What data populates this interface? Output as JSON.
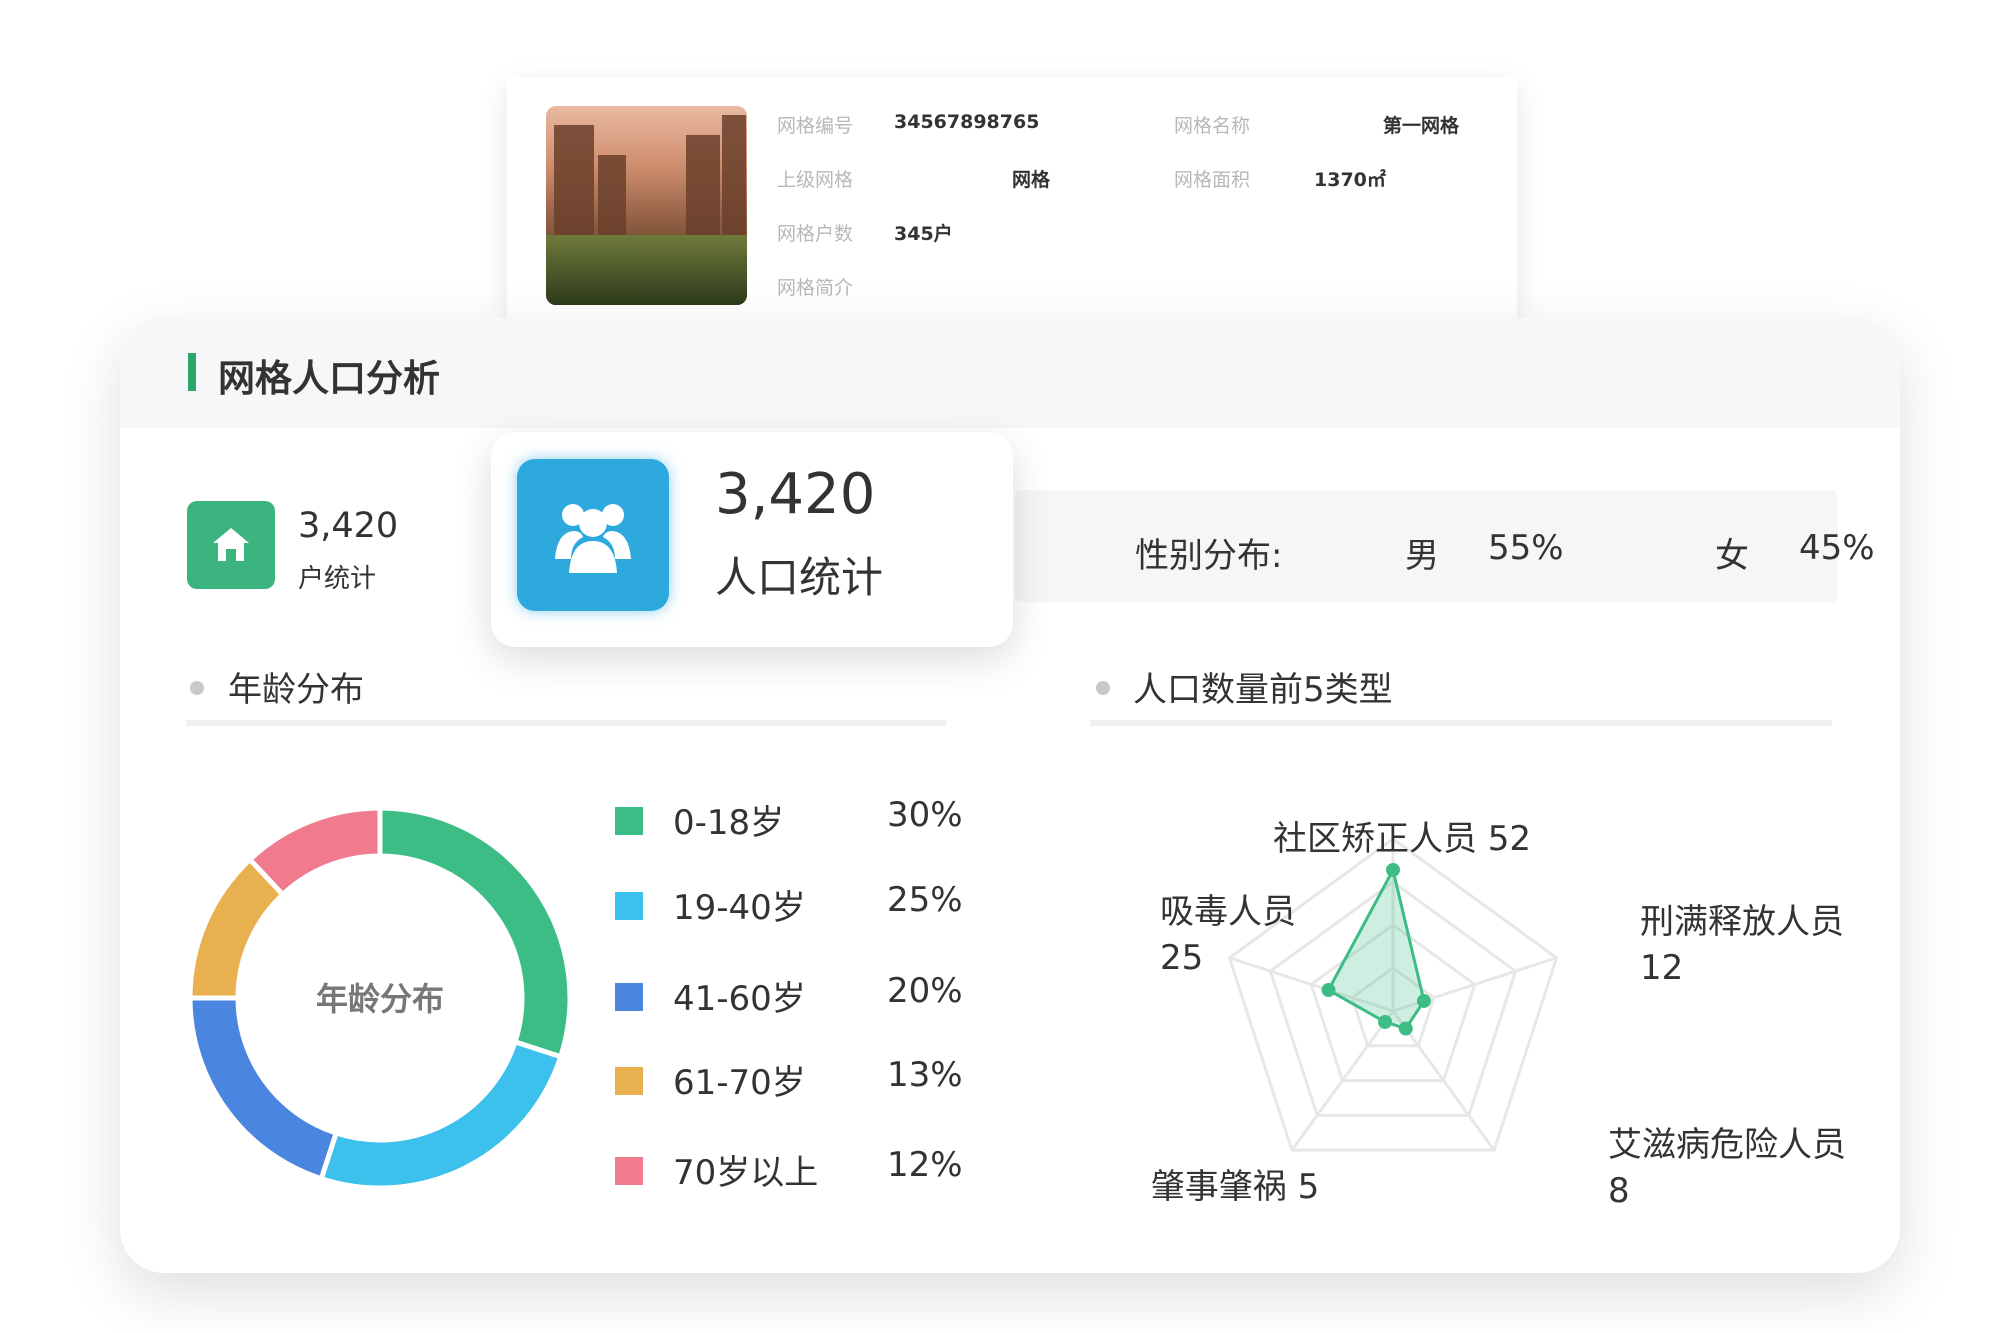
{
  "grid_info": {
    "fields": [
      {
        "label": "网格编号",
        "value": "34567898765"
      },
      {
        "label": "网格名称",
        "value": "第一网格"
      },
      {
        "label": "上级网格",
        "value": "网格"
      },
      {
        "label": "网格面积",
        "value": "1370㎡"
      },
      {
        "label": "网格户数",
        "value": "345户"
      },
      {
        "label": "网格简介",
        "value": ""
      }
    ]
  },
  "analysis": {
    "title": "网格人口分析",
    "households": {
      "value": "3,420",
      "label": "户统计"
    },
    "population": {
      "value": "3,420",
      "label": "人口统计"
    },
    "gender": {
      "label": "性别分布:",
      "male_label": "男",
      "male_pct": "55%",
      "female_label": "女",
      "female_pct": "45%"
    },
    "age_section_title": "年龄分布",
    "type_section_title": "人口数量前5类型"
  },
  "chart_data": [
    {
      "type": "pie",
      "center_label": "年龄分布",
      "categories": [
        "0-18岁",
        "19-40岁",
        "41-60岁",
        "61-70岁",
        "70岁以上"
      ],
      "values": [
        30,
        25,
        20,
        13,
        12
      ],
      "value_labels": [
        "30%",
        "25%",
        "20%",
        "13%",
        "12%"
      ],
      "colors": [
        "#3dbd86",
        "#3cc0ec",
        "#4a86e0",
        "#e8b04f",
        "#f17b8e"
      ]
    },
    {
      "type": "radar",
      "categories": [
        "社区矫正人员",
        "刑满释放人员",
        "艾滋病危险人员",
        "肇事肇祸",
        "吸毒人员"
      ],
      "values": [
        52,
        12,
        8,
        5,
        25
      ],
      "color": "#3dbd86"
    }
  ]
}
